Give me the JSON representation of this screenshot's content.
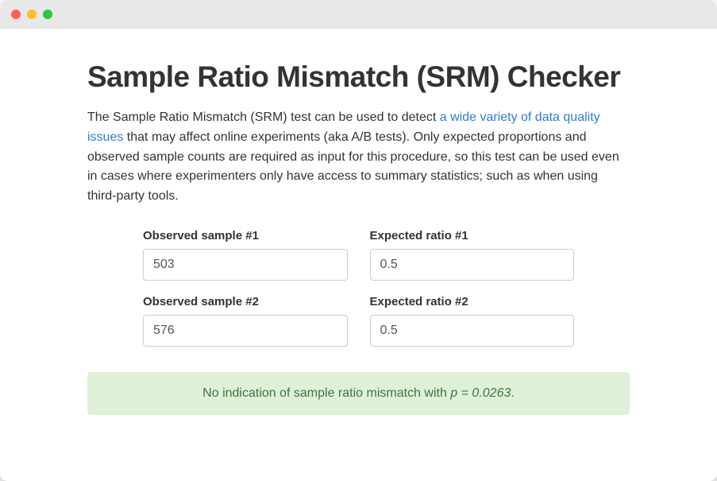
{
  "header": {
    "title": "Sample Ratio Mismatch (SRM) Checker"
  },
  "intro": {
    "text_before": "The Sample Ratio Mismatch (SRM) test can be used to detect ",
    "link_text": "a wide variety of data quality issues",
    "text_after": " that may affect online experiments (aka A/B tests). Only expected proportions and observed sample counts are required as input for this procedure, so this test can be used even in cases where experimenters only have access to summary statistics; such as when using third-party tools."
  },
  "form": {
    "observed1": {
      "label": "Observed sample #1",
      "value": "503"
    },
    "expected1": {
      "label": "Expected ratio #1",
      "value": "0.5"
    },
    "observed2": {
      "label": "Observed sample #2",
      "value": "576"
    },
    "expected2": {
      "label": "Expected ratio #2",
      "value": "0.5"
    }
  },
  "result": {
    "text_before": "No indication of sample ratio mismatch with ",
    "p_label": "p = 0.0263",
    "text_after": "."
  },
  "colors": {
    "link": "#2f7dd1",
    "success_bg": "#dff0d8",
    "success_text": "#3c763d"
  }
}
